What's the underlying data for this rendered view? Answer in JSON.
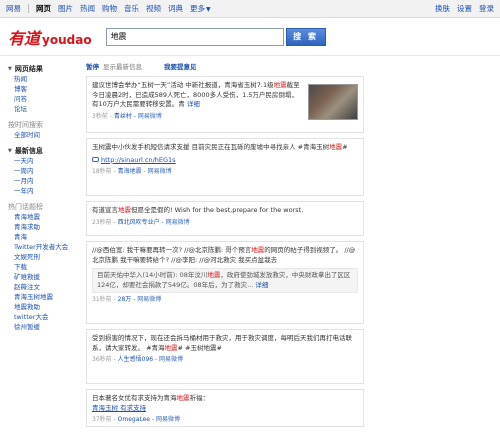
{
  "topnav": {
    "left": [
      "网易",
      "网页",
      "图片",
      "热闻",
      "购物",
      "音乐",
      "视频",
      "词典",
      "更多"
    ],
    "right": [
      "换肤",
      "设置",
      "登录"
    ]
  },
  "header": {
    "logo_cn": "有道",
    "logo_en": "youdao",
    "search_value": "地震",
    "search_button": "搜 索"
  },
  "sidebar": {
    "groups": [
      {
        "title": "网页结果",
        "items": [
          "热闻",
          "博客",
          "问答",
          "论坛"
        ]
      },
      {
        "title": "按时间搜索",
        "grey": true,
        "items": [
          "全部时间"
        ]
      },
      {
        "title": "最新信息",
        "items": [
          "一天内",
          "一周内",
          "一月内",
          "一年内"
        ]
      },
      {
        "title": "热门话题榜",
        "grey": true,
        "items": [
          "青海地震",
          "青海求助",
          "青海",
          "Twitter开发者大会",
          "文娱死刑",
          "下载",
          "矿难救援",
          "赵薇注文",
          "青海玉树地震",
          "地震救助",
          "twitter大会",
          "徐州暂缓"
        ]
      }
    ]
  },
  "toolbar": {
    "pause": "暂停",
    "pause_text": "显示最新信息",
    "feedback": "我要提意见"
  },
  "results": [
    {
      "text_a": "建议世博会举办“五树一天”活动 中新社报道，青海省玉树7.1级",
      "hl": "地震",
      "text_b": "截至今日凌晨2时，已造成589人死亡，8000多人受伤，1.5万户民房倒塌，有10万户大民需要转移安置。青",
      "detail": "详细",
      "meta_time": "3秒前 - ",
      "meta_user": "青丝村",
      "meta_source": " - 网易微博"
    },
    {
      "text_a": "玉树震中小伙发手机短信请求支援 目前灾民正在瓦砾的废墟中寻找亲人 #青海玉树",
      "hl": "地震",
      "text_b": "#",
      "link": "http://sinaurl.cn/hEG1s",
      "meta_time": "18秒前 - ",
      "meta_user": "青海地震",
      "meta_source": " - 网易微博"
    },
    {
      "text_a": "有道宣言",
      "hl": "地震",
      "text_b": "但愿全是假的! Wish for the best,prepare for the worst.",
      "meta_time": "23秒前 - ",
      "meta_user": "西北风吹专业户",
      "meta_source": " - 网易微博"
    },
    {
      "text_a": "//@西伯宽: 我干嘛要再转一次? //@北京陈鹏: 哥个预言",
      "hl": "地震",
      "text_b": "的网页的帖子得到视频了。 //@北京陈鹏 我干嘛要转给个? //@李阳: //@河北救灾 我买点盆栽去",
      "quote_a": "目前天佑中华入(14小时前): 08年汶川",
      "quote_hl": "地震",
      "quote_b": "，政府使劲城发放救灾，中央财政拿出了区区124亿，却要社会捐款了549亿。08年后，为了救灾...",
      "detail": "详细",
      "meta_time": "31秒前 - ",
      "meta_user": "28万",
      "meta_source": " - 网易微博"
    },
    {
      "text_a": "受到损害的情况下，现在还会拆马桶材用于救灾，用于救灾调度，每明后天我们再打电话联系，请大家转发。 #青海",
      "hl": "地震",
      "text_b": "# #玉树地震#",
      "meta_time": "36秒前 - ",
      "meta_user": "人生感悟096",
      "meta_source": " - 网易微博"
    },
    {
      "text_a": "日本著名女优有求支持为青海",
      "hl": "地震",
      "text_b": "祈福：",
      "sub": "青海玉树 有求支持",
      "meta_time": "37秒前 - ",
      "meta_user": "OmegaLee",
      "meta_source": " - 网易微博"
    }
  ]
}
